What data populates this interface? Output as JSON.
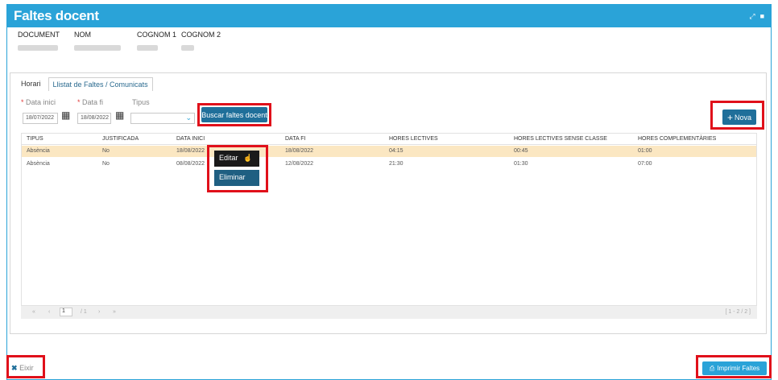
{
  "window": {
    "title": "Faltes docent",
    "controls": [
      "⤢",
      "■"
    ]
  },
  "header": {
    "columns": [
      {
        "label": "DOCUMENT"
      },
      {
        "label": "NOM"
      },
      {
        "label": "COGNOM 1"
      },
      {
        "label": "COGNOM 2"
      }
    ]
  },
  "tabs": [
    {
      "label": "Horari"
    },
    {
      "label": "Llistat de Faltes / Comunicats"
    }
  ],
  "filters": {
    "date_from_label": "Data inici",
    "date_from_value": "18/07/2022",
    "date_to_label": "Data fi",
    "date_to_value": "18/08/2022",
    "type_label": "Tipus",
    "type_value": "",
    "required_mark": "*",
    "search_button": "Buscar faltes docent",
    "new_button": "Nova",
    "new_icon": "+"
  },
  "table": {
    "columns": [
      "TIPUS",
      "JUSTIFICADA",
      "DATA INICI",
      "DATA FI",
      "HORES LECTIVES",
      "HORES LECTIVES SENSE CLASSE",
      "HORES COMPLEMENTÀRIES"
    ],
    "rows": [
      {
        "tipus": "Absència",
        "justificada": "No",
        "data_inici": "18/08/2022",
        "data_fi": "18/08/2022",
        "hores_lectives": "04:15",
        "hores_sense_classe": "00:45",
        "hores_complementaries": "01:00"
      },
      {
        "tipus": "Absència",
        "justificada": "No",
        "data_inici": "08/08/2022",
        "data_fi": "12/08/2022",
        "hores_lectives": "21:30",
        "hores_sense_classe": "01:30",
        "hores_complementaries": "07:00"
      }
    ]
  },
  "pager": {
    "first": "«",
    "prev": "‹",
    "page": "1",
    "of": "/ 1",
    "next": "›",
    "last": "»",
    "range": "[ 1 - 2 / 2 ]"
  },
  "context_menu": {
    "edit": "Editar",
    "delete": "Eliminar"
  },
  "footer": {
    "exit_label": "Eixir",
    "exit_icon": "✖",
    "print_label": "Imprimir Faltes",
    "print_icon": "⎙"
  },
  "colors": {
    "accent": "#2aa3d8",
    "primary_button": "#1f6f9a",
    "selected_row": "#fbe7c2",
    "highlight_box": "#e0101a"
  }
}
